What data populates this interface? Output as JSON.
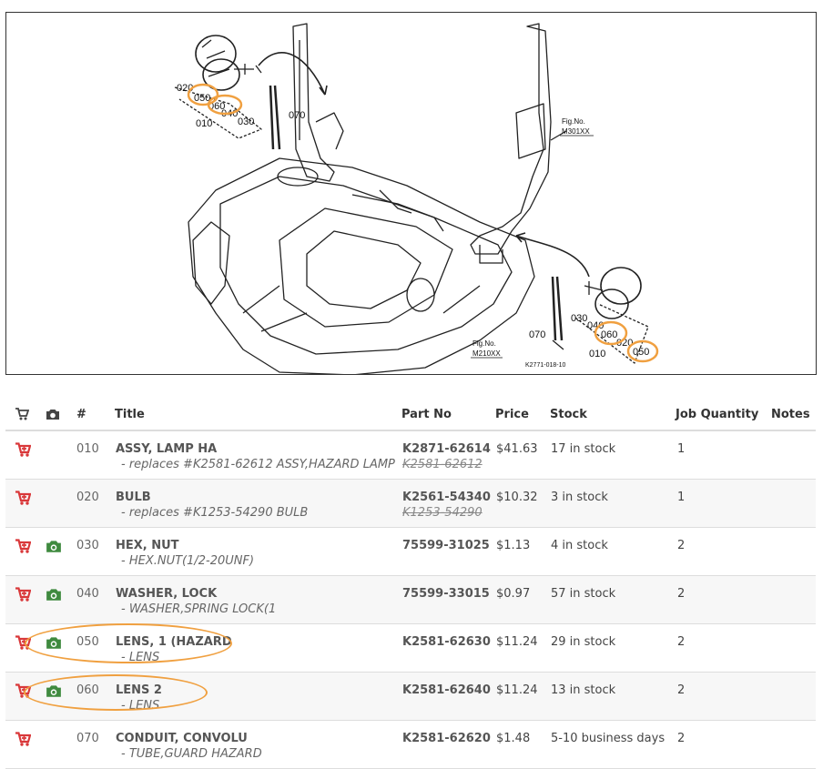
{
  "diagram": {
    "callouts": {
      "left_020": "020",
      "left_050": "050",
      "left_060": "060",
      "left_040": "040",
      "left_030": "030",
      "left_070": "070",
      "left_010": "010",
      "right_030": "030",
      "right_040": "040",
      "right_060": "060",
      "right_020": "020",
      "right_050": "050",
      "right_070": "070",
      "right_010": "010"
    },
    "fig_301_label": "Fig.No.",
    "fig_301_number": "M301XX",
    "fig_210_label": "Fig.No.",
    "fig_210_number": "M210XX",
    "drawing_code": "K2771-018-10"
  },
  "table": {
    "headers": {
      "number": "#",
      "title": "Title",
      "part_no": "Part No",
      "price": "Price",
      "stock": "Stock",
      "job_quantity": "Job Quantity",
      "notes": "Notes"
    },
    "rows": [
      {
        "num": "010",
        "title": "ASSY, LAMP HA",
        "subtitle": "- replaces #K2581-62612 ASSY,HAZARD LAMP",
        "part": "K2871-62614",
        "old_part": "K2581-62612",
        "price": "$41.63",
        "stock": "17 in stock",
        "qty": "1",
        "has_photo": false
      },
      {
        "num": "020",
        "title": "BULB",
        "subtitle": "- replaces #K1253-54290 BULB",
        "part": "K2561-54340",
        "old_part": "K1253-54290",
        "price": "$10.32",
        "stock": "3 in stock",
        "qty": "1",
        "has_photo": false
      },
      {
        "num": "030",
        "title": "HEX, NUT",
        "subtitle": "- HEX.NUT(1/2-20UNF)",
        "part": "75599-31025",
        "old_part": "",
        "price": "$1.13",
        "stock": "4 in stock",
        "qty": "2",
        "has_photo": true
      },
      {
        "num": "040",
        "title": "WASHER, LOCK",
        "subtitle": "- WASHER,SPRING LOCK(1",
        "part": "75599-33015",
        "old_part": "",
        "price": "$0.97",
        "stock": "57 in stock",
        "qty": "2",
        "has_photo": true
      },
      {
        "num": "050",
        "title": "LENS, 1 (HAZARD",
        "subtitle": "- LENS",
        "part": "K2581-62630",
        "old_part": "",
        "price": "$11.24",
        "stock": "29 in stock",
        "qty": "2",
        "has_photo": true
      },
      {
        "num": "060",
        "title": "LENS 2",
        "subtitle": "- LENS",
        "part": "K2581-62640",
        "old_part": "",
        "price": "$11.24",
        "stock": "13 in stock",
        "qty": "2",
        "has_photo": true
      },
      {
        "num": "070",
        "title": "CONDUIT, CONVOLU",
        "subtitle": "- TUBE,GUARD HAZARD",
        "part": "K2581-62620",
        "old_part": "",
        "price": "$1.48",
        "stock": "5-10 business days",
        "qty": "2",
        "has_photo": false
      }
    ]
  },
  "icons": {
    "cart": "add-to-cart-icon",
    "camera": "camera-icon"
  },
  "colors": {
    "cart": "#d9383a",
    "camera": "#3f8a3f",
    "highlight": "#f0a040"
  }
}
